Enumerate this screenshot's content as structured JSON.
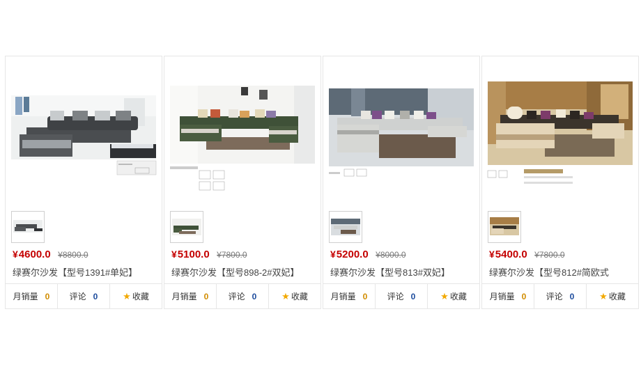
{
  "colors": {
    "price": "#c40000",
    "sales_count": "#d18c00",
    "review_count": "#1c4b9c",
    "star": "#f2a900",
    "border": "#e6e6e6"
  },
  "icons": {
    "favorite": "star-icon"
  },
  "products": [
    {
      "currency": "¥",
      "price": "4600.0",
      "old_price": "¥8800.0",
      "title": "绿赛尔沙发【型号1391#单妃】",
      "sales_label": "月销量",
      "sales_count": "0",
      "review_label": "评论",
      "review_count": "0",
      "fav_label": "收藏"
    },
    {
      "currency": "¥",
      "price": "5100.0",
      "old_price": "¥7800.0",
      "title": "绿赛尔沙发【型号898-2#双妃】",
      "sales_label": "月销量",
      "sales_count": "0",
      "review_label": "评论",
      "review_count": "0",
      "fav_label": "收藏"
    },
    {
      "currency": "¥",
      "price": "5200.0",
      "old_price": "¥8000.0",
      "title": "绿赛尔沙发【型号813#双妃】",
      "sales_label": "月销量",
      "sales_count": "0",
      "review_label": "评论",
      "review_count": "0",
      "fav_label": "收藏"
    },
    {
      "currency": "¥",
      "price": "5400.0",
      "old_price": "¥7800.0",
      "title": "绿赛尔沙发【型号812#简欧式",
      "sales_label": "月销量",
      "sales_count": "0",
      "review_label": "评论",
      "review_count": "0",
      "fav_label": "收藏"
    }
  ]
}
